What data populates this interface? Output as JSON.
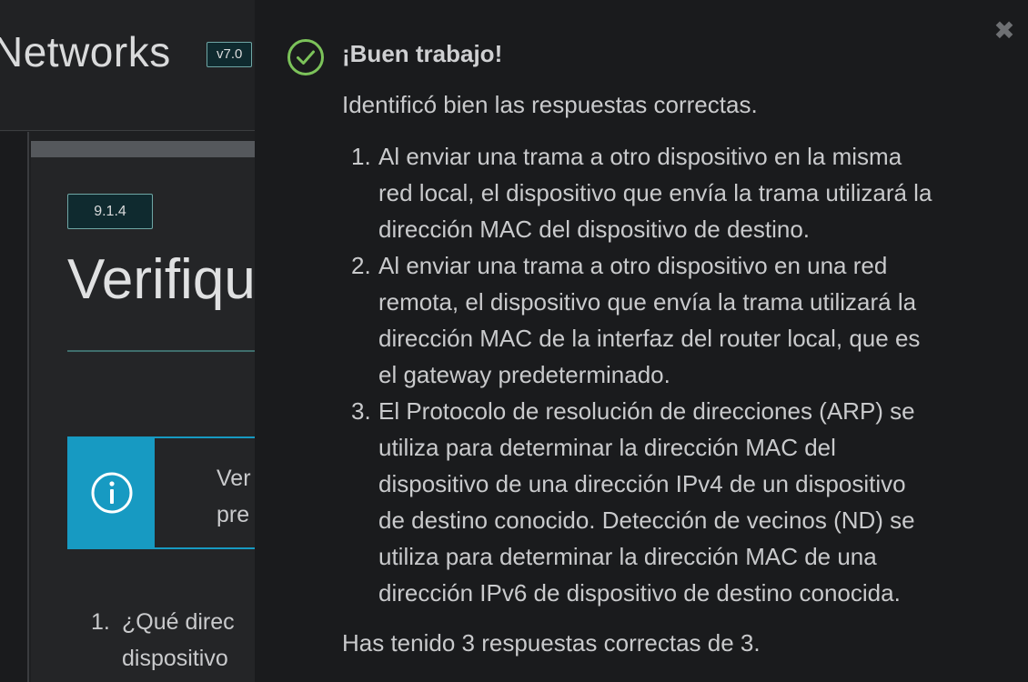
{
  "header": {
    "course_title": "Networks",
    "version": "v7.0"
  },
  "content": {
    "section_number": "9.1.4",
    "section_heading": "Verifiqu",
    "info_box": {
      "icon": "info-icon",
      "lines": [
        "Ver",
        "pre"
      ]
    },
    "question": {
      "number": "1.",
      "lines": [
        "¿Qué direc",
        "dispositivo"
      ]
    }
  },
  "feedback": {
    "icon": "check-circle-icon",
    "accent_color": "#7cc35a",
    "title": "¡Buen trabajo!",
    "intro": "Identificó bien las respuestas correctas.",
    "answers": [
      {
        "number": "1.",
        "lines": [
          "Al enviar una trama a otro dispositivo en la misma",
          "red local, el dispositivo que envía la trama utilizará la",
          "dirección MAC del dispositivo de destino."
        ]
      },
      {
        "number": "2.",
        "lines": [
          "Al enviar una trama a otro dispositivo en una red",
          "remota, el dispositivo que envía la trama utilizará la",
          "dirección MAC de la interfaz del router local, que es",
          "el gateway predeterminado."
        ]
      },
      {
        "number": "3.",
        "lines": [
          "El Protocolo de resolución de direcciones (ARP) se",
          "utiliza para determinar la dirección MAC del",
          "dispositivo de una dirección IPv4 de un dispositivo",
          "de destino conocido. Detección de vecinos (ND) se",
          "utiliza para determinar la dirección MAC de una",
          "dirección IPv6 de dispositivo de destino conocida."
        ]
      }
    ],
    "score": "Has tenido 3 respuestas correctas de 3.",
    "close_icon": "close-icon"
  }
}
